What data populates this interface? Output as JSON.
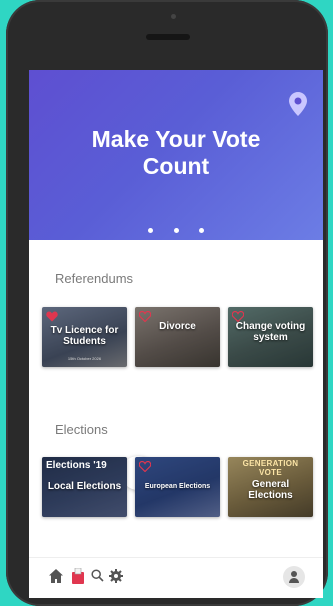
{
  "hero": {
    "title": "Make Your Vote Count"
  },
  "sections": {
    "referendums_label": "Referendums",
    "elections_label": "Elections"
  },
  "referendums": [
    {
      "title": "Tv Licence for Students",
      "date": "15th October 2026"
    },
    {
      "title": "Divorce",
      "date": ""
    },
    {
      "title": "Change voting system",
      "date": ""
    }
  ],
  "elections": [
    {
      "title": "Local Elections",
      "banner": "Elections '19",
      "date": ""
    },
    {
      "title": "European Elections",
      "date": ""
    },
    {
      "title": "General Elections",
      "banner": "GENERATION VOTE",
      "date": ""
    }
  ],
  "colors": {
    "accent_teal": "#2fd6c3",
    "hero_purple": "#5e4fd1",
    "heart_red": "#e0364f"
  },
  "icons": {
    "location": "location-pin-icon",
    "home": "home-icon",
    "ballot": "ballot-icon",
    "search": "search-icon",
    "settings": "gear-icon",
    "profile": "profile-icon"
  }
}
